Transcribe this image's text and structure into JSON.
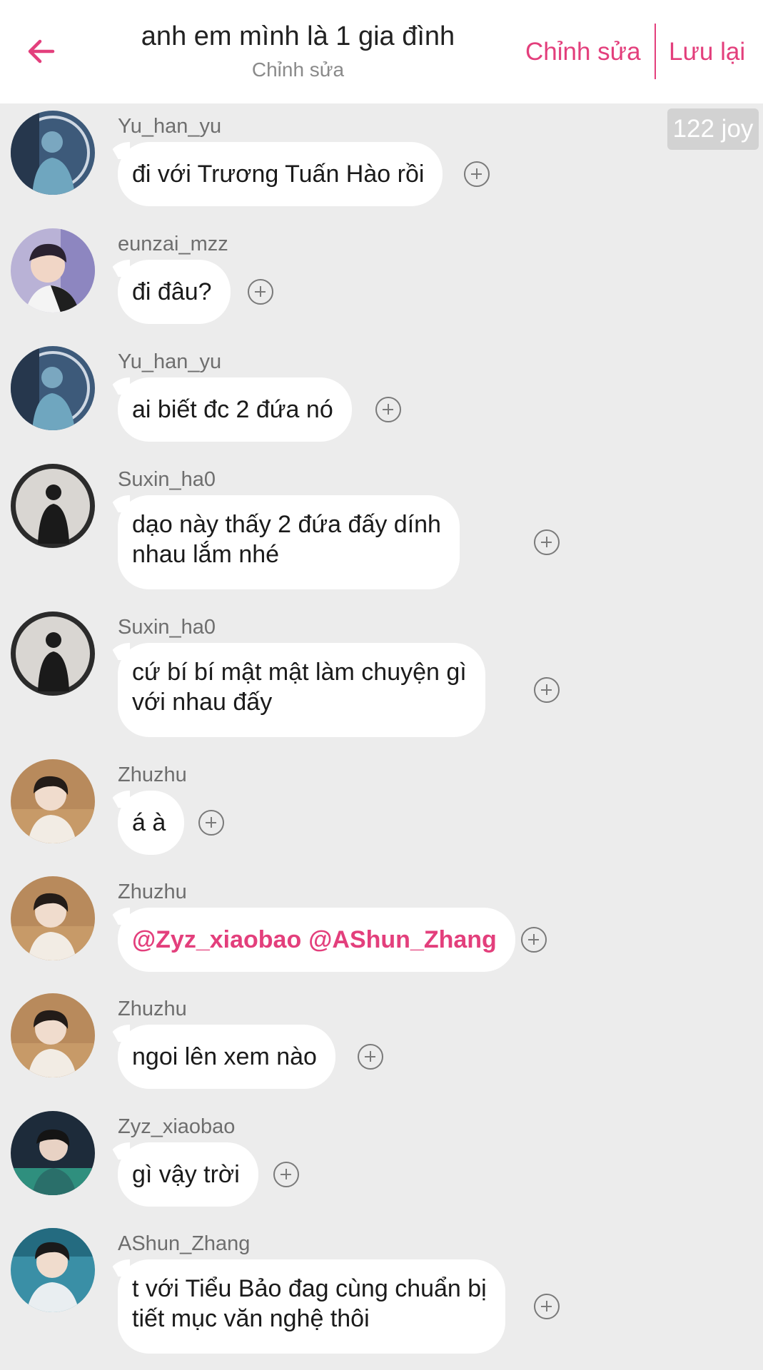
{
  "header": {
    "title": "anh em mình là 1 gia đình",
    "subtitle": "Chỉnh sửa",
    "edit_label": "Chỉnh sửa",
    "save_label": "Lưu lại",
    "back_icon": "arrow-left-icon",
    "accent": "#e33f7c"
  },
  "joy_badge": "122 joy",
  "messages": [
    {
      "user": "Yu_han_yu",
      "text": "đi với Trương Tuấn Hào rồi",
      "avatar": "yu-han-yu"
    },
    {
      "user": "eunzai_mzz",
      "text": "đi đâu?",
      "avatar": "eunzai-mzz"
    },
    {
      "user": "Yu_han_yu",
      "text": "ai biết đc 2 đứa nó",
      "avatar": "yu-han-yu"
    },
    {
      "user": "Suxin_ha0",
      "line1": "dạo này thấy 2 đứa đấy dính",
      "line2": "nhau lắm nhé",
      "avatar": "suxin-ha0"
    },
    {
      "user": "Suxin_ha0",
      "line1": "cứ bí bí mật mật làm chuyện gì",
      "line2": "với nhau đấy",
      "avatar": "suxin-ha0"
    },
    {
      "user": "Zhuzhu",
      "text": "á à",
      "avatar": "zhuzhu"
    },
    {
      "user": "Zhuzhu",
      "mention1": "@Zyz_xiaobao",
      "mention2": "@AShun_Zhang",
      "avatar": "zhuzhu"
    },
    {
      "user": "Zhuzhu",
      "text": "ngoi lên xem nào",
      "avatar": "zhuzhu"
    },
    {
      "user": "Zyz_xiaobao",
      "text": "gì vậy trời",
      "avatar": "zyz-xiaobao"
    },
    {
      "user": "AShun_Zhang",
      "line1": "t với Tiểu Bảo đag cùng chuẩn bị",
      "line2": "tiết mục văn nghệ thôi",
      "avatar": "ashun-zhang"
    }
  ],
  "add_reaction_icon": "plus-circle-icon"
}
